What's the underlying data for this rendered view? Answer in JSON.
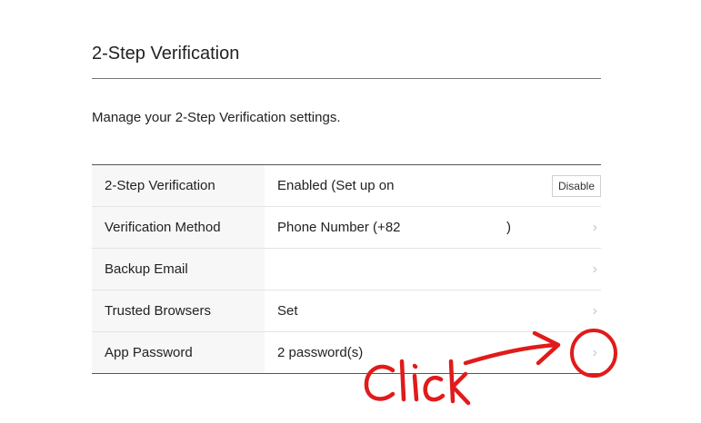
{
  "section": {
    "title": "2-Step Verification",
    "description": "Manage your 2-Step Verification settings."
  },
  "rows": [
    {
      "label": "2-Step Verification",
      "value": "Enabled (Set up on",
      "button_label": "Disable"
    },
    {
      "label": "Verification Method",
      "value": "Phone Number (+82",
      "value_suffix": ")"
    },
    {
      "label": "Backup Email",
      "value": ""
    },
    {
      "label": "Trusted Browsers",
      "value": "Set"
    },
    {
      "label": "App Password",
      "value": "2 password(s)"
    }
  ],
  "annotation": {
    "text": "Click",
    "color": "#e01b1b"
  },
  "icons": {
    "chevron": "chevron-right-icon"
  }
}
